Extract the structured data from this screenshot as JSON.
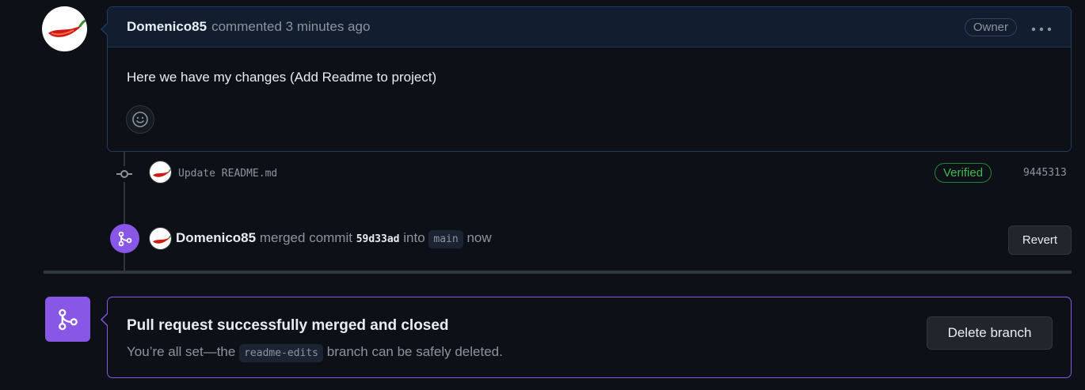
{
  "comment": {
    "author": "Domenico85",
    "action": "commented 3 minutes ago",
    "badge": "Owner",
    "body": "Here we have my changes (Add Readme to project)",
    "avatar_icon": "chili-pepper-avatar",
    "menu_icon": "kebab-horizontal-icon",
    "reaction_icon": "smiley-icon"
  },
  "commit": {
    "message": "Update README.md",
    "verified_label": "Verified",
    "sha": "9445313"
  },
  "merge_event": {
    "author": "Domenico85",
    "text_merged": "merged commit",
    "commit_ref": "59d33ad",
    "text_into": "into",
    "branch": "main",
    "text_when": "now",
    "revert_label": "Revert"
  },
  "merged_box": {
    "title": "Pull request successfully merged and closed",
    "sub_prefix": "You’re all set—the",
    "branch": "readme-edits",
    "sub_suffix": "branch can be safely deleted.",
    "delete_label": "Delete branch"
  },
  "colors": {
    "background": "#0d1117",
    "merge_purple": "#8957e5",
    "verified_green": "#3fb950",
    "header_blue": "#121d2f"
  }
}
